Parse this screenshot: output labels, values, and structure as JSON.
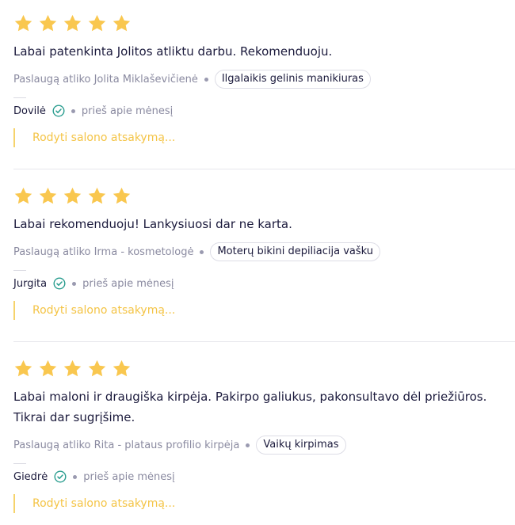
{
  "colors": {
    "star": "#f9c74f",
    "text": "#1b1a3c",
    "muted": "#8a8aa0",
    "verified": "#2a9d8f",
    "reply": "#f4c446"
  },
  "reviews": [
    {
      "rating": 5,
      "text": "Labai patenkinta Jolitos atliktu darbu. Rekomenduoju.",
      "performed_by": "Paslaugą atliko Jolita Miklaševičienė",
      "service": "Ilgalaikis gelinis manikiuras",
      "author": "Dovilė",
      "time_ago": "prieš apie mėnesį",
      "reply_label": "Rodyti salono atsakymą..."
    },
    {
      "rating": 5,
      "text": "Labai rekomenduoju! Lankysiuosi dar ne karta.",
      "performed_by": "Paslaugą atliko Irma - kosmetologė",
      "service": "Moterų bikini depiliacija vašku",
      "author": "Jurgita",
      "time_ago": "prieš apie mėnesį",
      "reply_label": "Rodyti salono atsakymą..."
    },
    {
      "rating": 5,
      "text": "Labai maloni ir draugiška kirpėja. Pakirpo galiukus, pakonsultavo dėl priežiūros. Tikrai dar sugrįšime.",
      "performed_by": "Paslaugą atliko Rita - plataus profilio kirpėja",
      "service": "Vaikų kirpimas",
      "author": "Giedrė",
      "time_ago": "prieš apie mėnesį",
      "reply_label": "Rodyti salono atsakymą..."
    }
  ]
}
